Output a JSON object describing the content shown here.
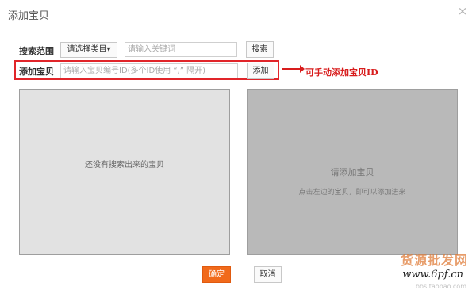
{
  "dialog": {
    "title": "添加宝贝",
    "close_glyph": "×"
  },
  "search": {
    "label": "搜索范围",
    "category_label": "请选择类目",
    "category_caret": "▾",
    "keyword_placeholder": "请输入关键词",
    "search_button": "搜索"
  },
  "add": {
    "label": "添加宝贝",
    "id_placeholder": "请输入宝贝编号ID(多个ID使用 “,” 隔开)",
    "add_button": "添加"
  },
  "annotation": {
    "text": "可手动添加宝贝ID",
    "color": "#d81d1d"
  },
  "left_panel": {
    "empty_text": "还没有搜索出来的宝贝"
  },
  "right_panel": {
    "title": "请添加宝贝",
    "hint": "点击左边的宝贝，即可以添加进来"
  },
  "footer": {
    "confirm": "确定",
    "cancel": "取消",
    "accent": "#f16a1b"
  },
  "watermark": {
    "cn": "货源批发网",
    "url": "www.6pf.cn",
    "sub": "bbs.taobao.com"
  }
}
